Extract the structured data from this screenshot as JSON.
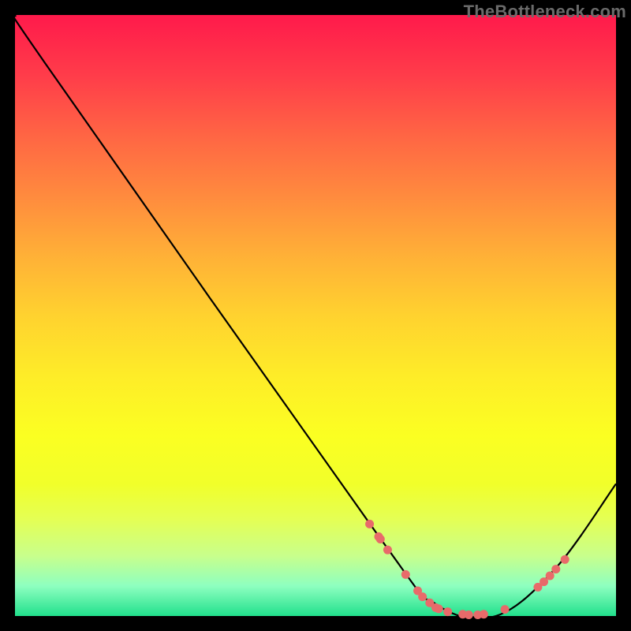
{
  "watermark": "TheBottleneck.com",
  "chart_data": {
    "type": "line",
    "title": "",
    "xlabel": "",
    "ylabel": "",
    "xlim": [
      0,
      100
    ],
    "ylim": [
      0,
      100
    ],
    "series": [
      {
        "name": "curve",
        "x": [
          0,
          5,
          60,
          70,
          80,
          90,
          100
        ],
        "y": [
          100,
          92,
          14,
          2,
          0,
          8,
          22
        ]
      }
    ],
    "marker_points": {
      "x": [
        59,
        60.5,
        60.8,
        62,
        65,
        67,
        67.8,
        69,
        70,
        70.5,
        72,
        74.5,
        75.5,
        77,
        78,
        81.5,
        87,
        88,
        89,
        90,
        91.5
      ],
      "y": [
        15.3,
        13.2,
        12.8,
        11.0,
        6.9,
        4.2,
        3.2,
        2.2,
        1.4,
        1.2,
        0.7,
        0.3,
        0.2,
        0.2,
        0.3,
        1.1,
        4.8,
        5.7,
        6.7,
        7.8,
        9.4
      ]
    },
    "colors": {
      "curve": "#000000",
      "marker": "#e86a6a",
      "frame": "#000000",
      "bg_top": "#ff1a4b",
      "bg_bottom": "#21e08c"
    }
  }
}
